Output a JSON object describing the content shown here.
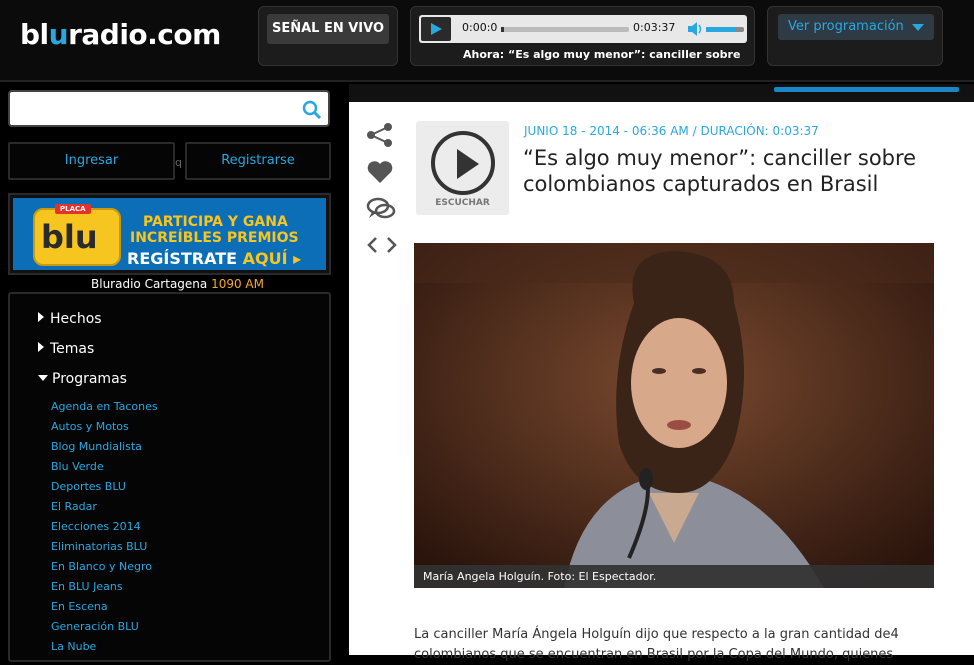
{
  "header": {
    "logo_pre": "bl",
    "logo_accent": "u",
    "logo_post": "radio.com",
    "live_label": "SEÑAL EN VIVO",
    "player": {
      "current_time": "0:00:0",
      "duration": "0:03:37",
      "progress": 0.02,
      "volume": 0.8,
      "now_playing": "Ahora: “Es algo muy menor”: canciller sobre"
    },
    "programming_label": "Ver programación"
  },
  "sidebar": {
    "search_placeholder": "",
    "login_label": "Ingresar",
    "register_label": "Registrarse",
    "fragment": "q",
    "promo": {
      "plaque": "PLACA",
      "logo_text": "blu",
      "line1": "PARTICIPA Y GANA",
      "line2": "INCREÍBLES PREMIOS",
      "line3_a": "REGÍSTRATE ",
      "line3_b": "AQUÍ ▸"
    },
    "station_name": "Bluradio Cartagena ",
    "station_freq": "1090 AM",
    "nav": {
      "hechos": "Hechos",
      "temas": "Temas",
      "programas": "Programas",
      "programs": [
        "Agenda en Tacones",
        "Autos y Motos",
        "Blog Mundialista",
        "Blu Verde",
        "Deportes BLU",
        "El Radar",
        "Elecciones 2014",
        "Eliminatorias BLU",
        "En Blanco y Negro",
        "En BLU Jeans",
        "En Escena",
        "Generación BLU",
        "La Nube"
      ]
    }
  },
  "article": {
    "listen_label": "ESCUCHAR",
    "meta": "JUNIO 18 - 2014 - 06:36 AM / DURACIÓN: 0:03:37",
    "title": "“Es algo muy menor”: canciller sobre colombianos capturados en Brasil",
    "caption": "María Angela Holguín. Foto: El Espectador.",
    "body": "La canciller María Ángela Holguín dijo que respecto a la gran cantidad de4 colombianos que se encuentran en Brasil por la Copa del Mundo, quienes"
  },
  "icons": {
    "share": "share-icon",
    "like": "heart-icon",
    "comment": "comment-icon",
    "embed": "code-icon",
    "search": "search-icon",
    "play": "play-icon",
    "volume": "volume-icon"
  },
  "colors": {
    "accent": "#29a8e0",
    "promo_yellow": "#f7c51f",
    "frequency": "#f7a91f"
  }
}
